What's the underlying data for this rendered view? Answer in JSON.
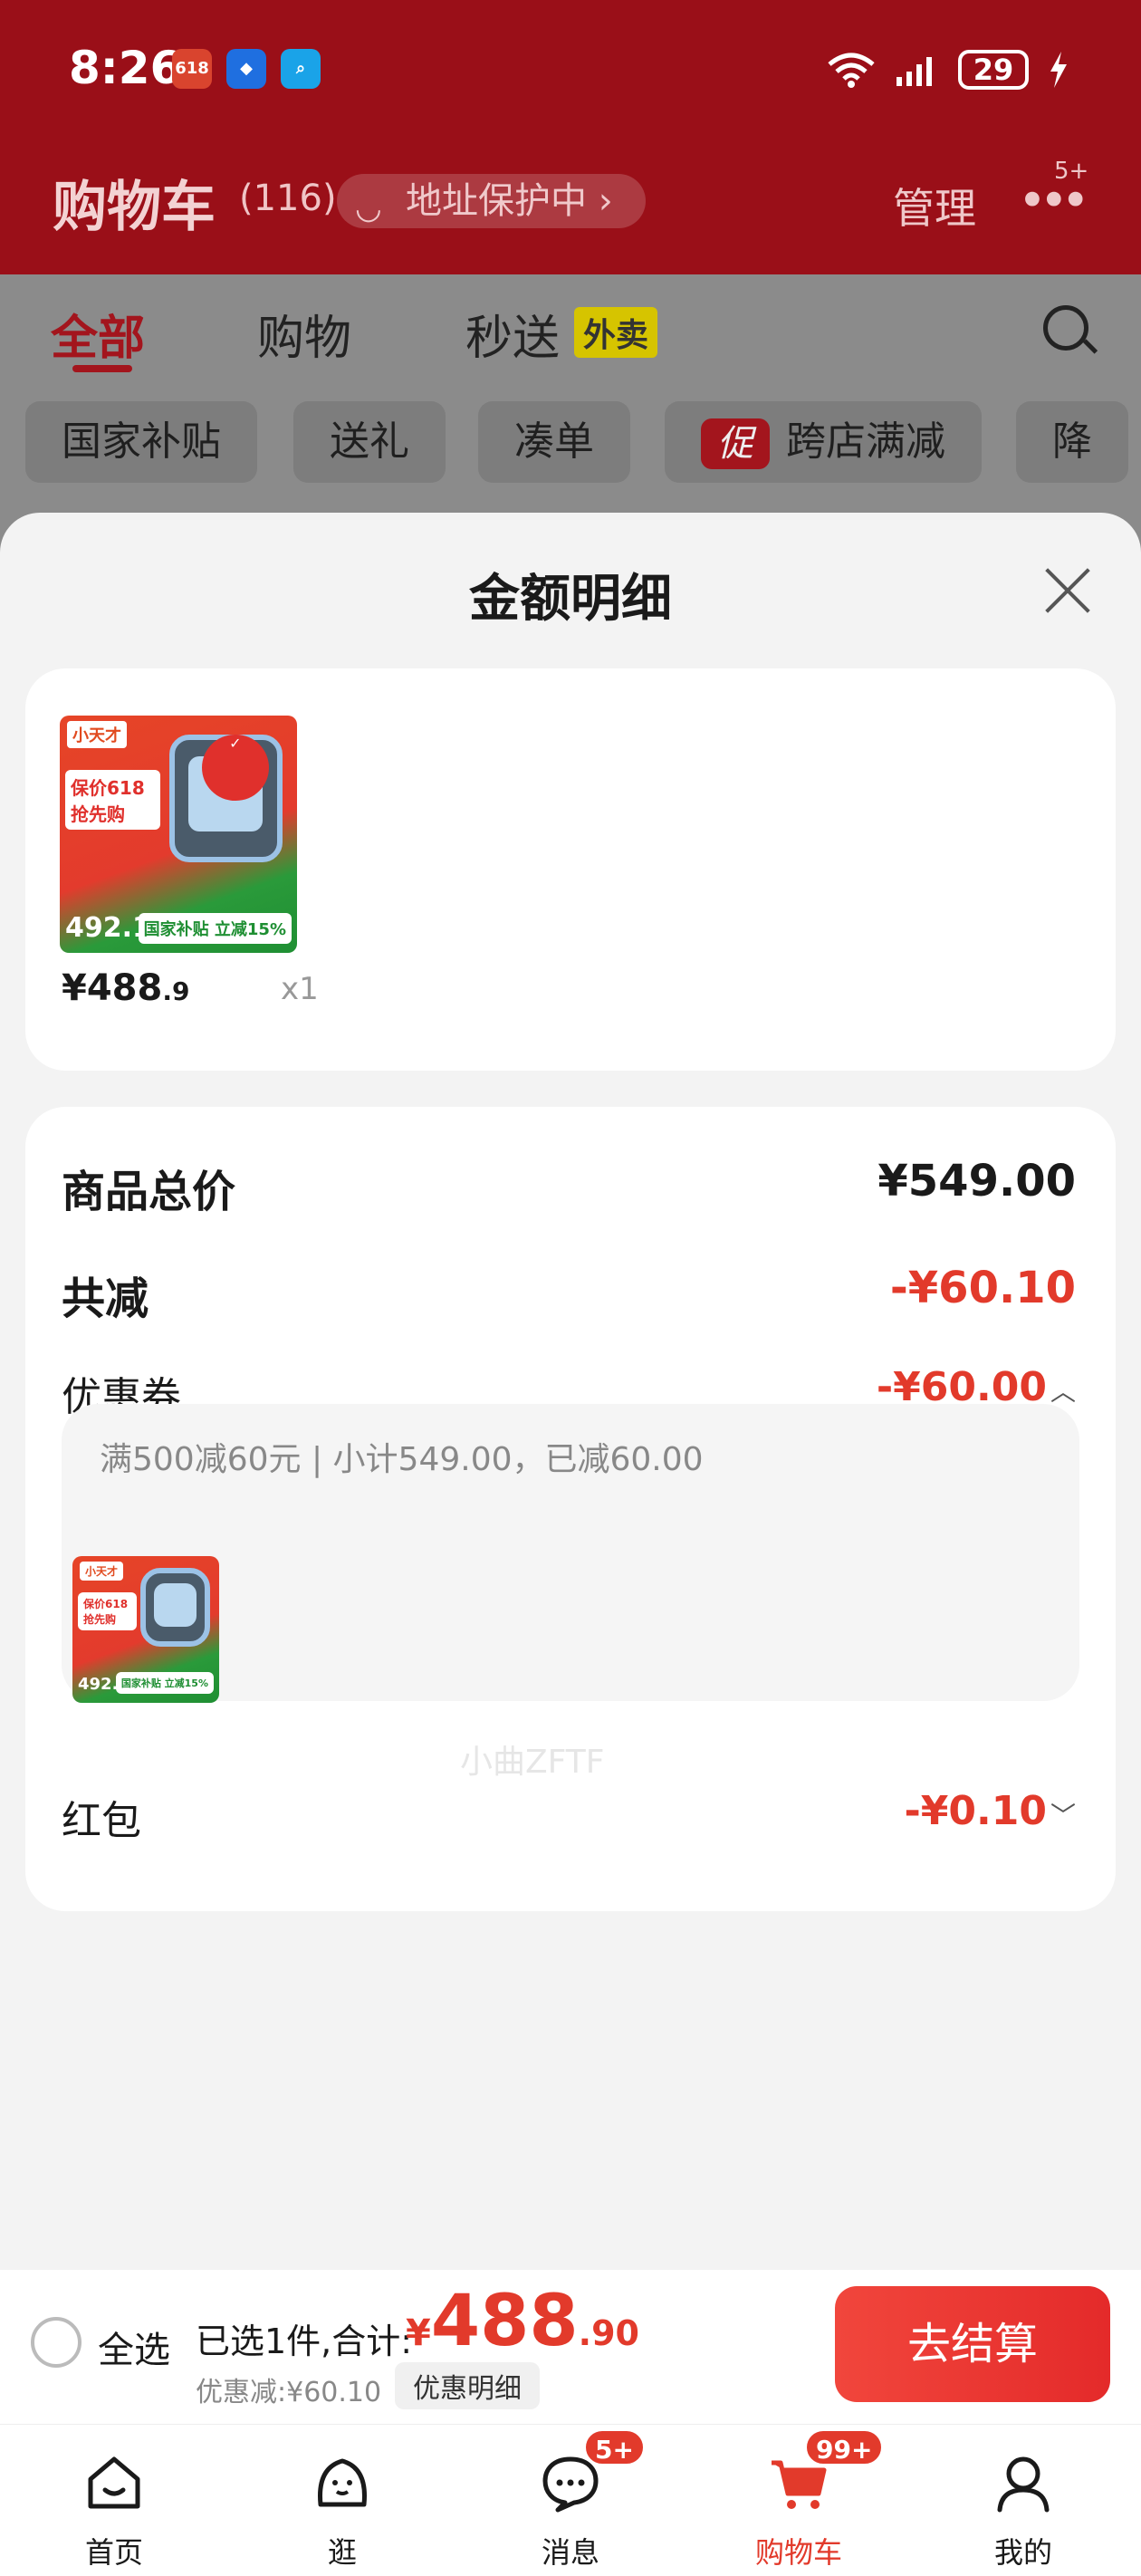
{
  "status_bar": {
    "time": "8:26",
    "apps": [
      "618",
      "",
      ""
    ],
    "battery": "29"
  },
  "header": {
    "title": "购物车",
    "count": "(116)",
    "address_protect": "地址保护中",
    "manage": "管理",
    "more_badge": "5+"
  },
  "tabs": [
    {
      "label": "全部"
    },
    {
      "label": "购物"
    },
    {
      "label": "秒送"
    }
  ],
  "waimai_tag": "外卖",
  "chips": [
    "国家补贴",
    "送礼",
    "凑单",
    "跨店满减",
    "降"
  ],
  "promo_tag": "促",
  "sheet": {
    "title": "金额明细",
    "item": {
      "price_int": "¥488",
      "price_dec": ".9",
      "qty": "x1"
    },
    "product_image": {
      "brand": "小天才",
      "promo": "保价618 抢先购",
      "price": "492.15",
      "gov": "国家补贴 立减15%"
    },
    "rows": {
      "total_label": "商品总价",
      "total_value": "¥549.00",
      "reduce_label": "共减",
      "reduce_value": "-¥60.10",
      "coupon_label": "优惠券",
      "coupon_value": "-¥60.00",
      "coupon_detail": "满500减60元 | 小计549.00，已减60.00",
      "redpacket_label": "红包",
      "redpacket_value": "-¥0.10"
    },
    "watermark": "小曲ZFTF"
  },
  "checkout": {
    "select_all": "全选",
    "selected_text": "已选1件,合计:",
    "currency": "¥",
    "amount_int": "488",
    "amount_dec": ".90",
    "discount": "优惠减:¥60.10",
    "detail_button": "优惠明细",
    "pay_button": "去结算"
  },
  "tabbar": [
    {
      "label": "首页",
      "icon": "home-icon"
    },
    {
      "label": "逛",
      "icon": "browse-icon"
    },
    {
      "label": "消息",
      "icon": "message-icon",
      "badge": "5+"
    },
    {
      "label": "购物车",
      "icon": "cart-icon",
      "badge": "99+"
    },
    {
      "label": "我的",
      "icon": "profile-icon"
    }
  ],
  "colors": {
    "brand_red": "#e23a2b",
    "header_red": "#9a0f18"
  }
}
